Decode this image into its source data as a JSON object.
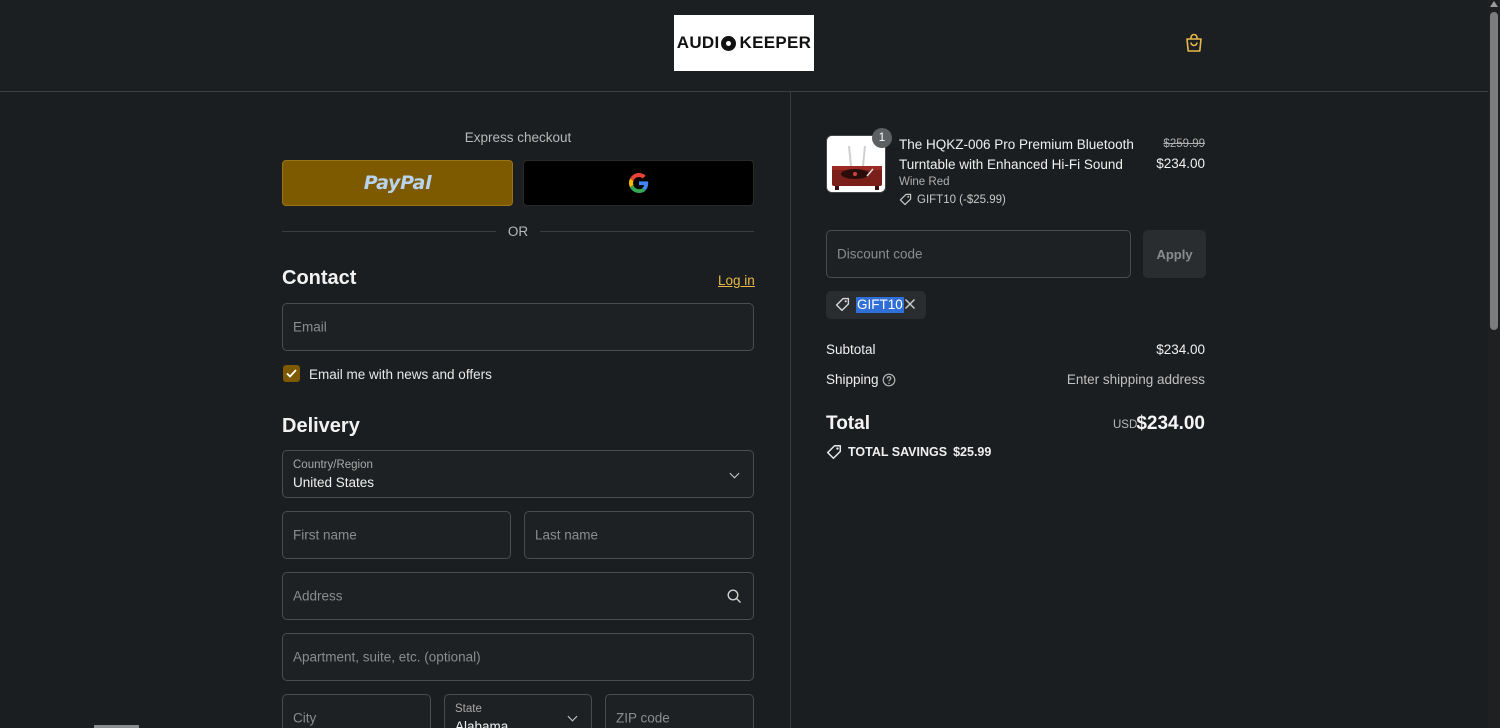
{
  "header": {
    "logo_left": "AUDI",
    "logo_right": "KEEPER",
    "cart_icon": "shopping-bag-icon"
  },
  "express": {
    "label": "Express checkout",
    "paypal_label": "PayPal",
    "gpay_icon": "google-icon",
    "or_text": "OR"
  },
  "contact": {
    "title": "Contact",
    "login_label": "Log in",
    "email_placeholder": "Email",
    "newsletter_label": "Email me with news and offers",
    "newsletter_checked": true
  },
  "delivery": {
    "title": "Delivery",
    "country_label": "Country/Region",
    "country_value": "United States",
    "first_name_placeholder": "First name",
    "last_name_placeholder": "Last name",
    "address_placeholder": "Address",
    "apartment_placeholder": "Apartment, suite, etc. (optional)",
    "city_placeholder": "City",
    "state_label": "State",
    "state_value": "Alabama",
    "zip_placeholder": "ZIP code"
  },
  "order": {
    "item": {
      "quantity": "1",
      "name": "The HQKZ-006 Pro Premium Bluetooth Turntable with Enhanced Hi-Fi Sound",
      "variant": "Wine Red",
      "discount": "GIFT10 (-$25.99)",
      "price_original": "$259.99",
      "price_final": "$234.00"
    },
    "discount_placeholder": "Discount code",
    "apply_label": "Apply",
    "applied_code": "GIFT10",
    "subtotal_label": "Subtotal",
    "subtotal_value": "$234.00",
    "shipping_label": "Shipping",
    "shipping_value": "Enter shipping address",
    "total_label": "Total",
    "total_currency": "USD",
    "total_value": "$234.00",
    "savings_label": "TOTAL SAVINGS",
    "savings_value": "$25.99"
  },
  "colors": {
    "accent": "#7d5a00",
    "link": "#e8b84a",
    "background": "#1b1e20"
  }
}
